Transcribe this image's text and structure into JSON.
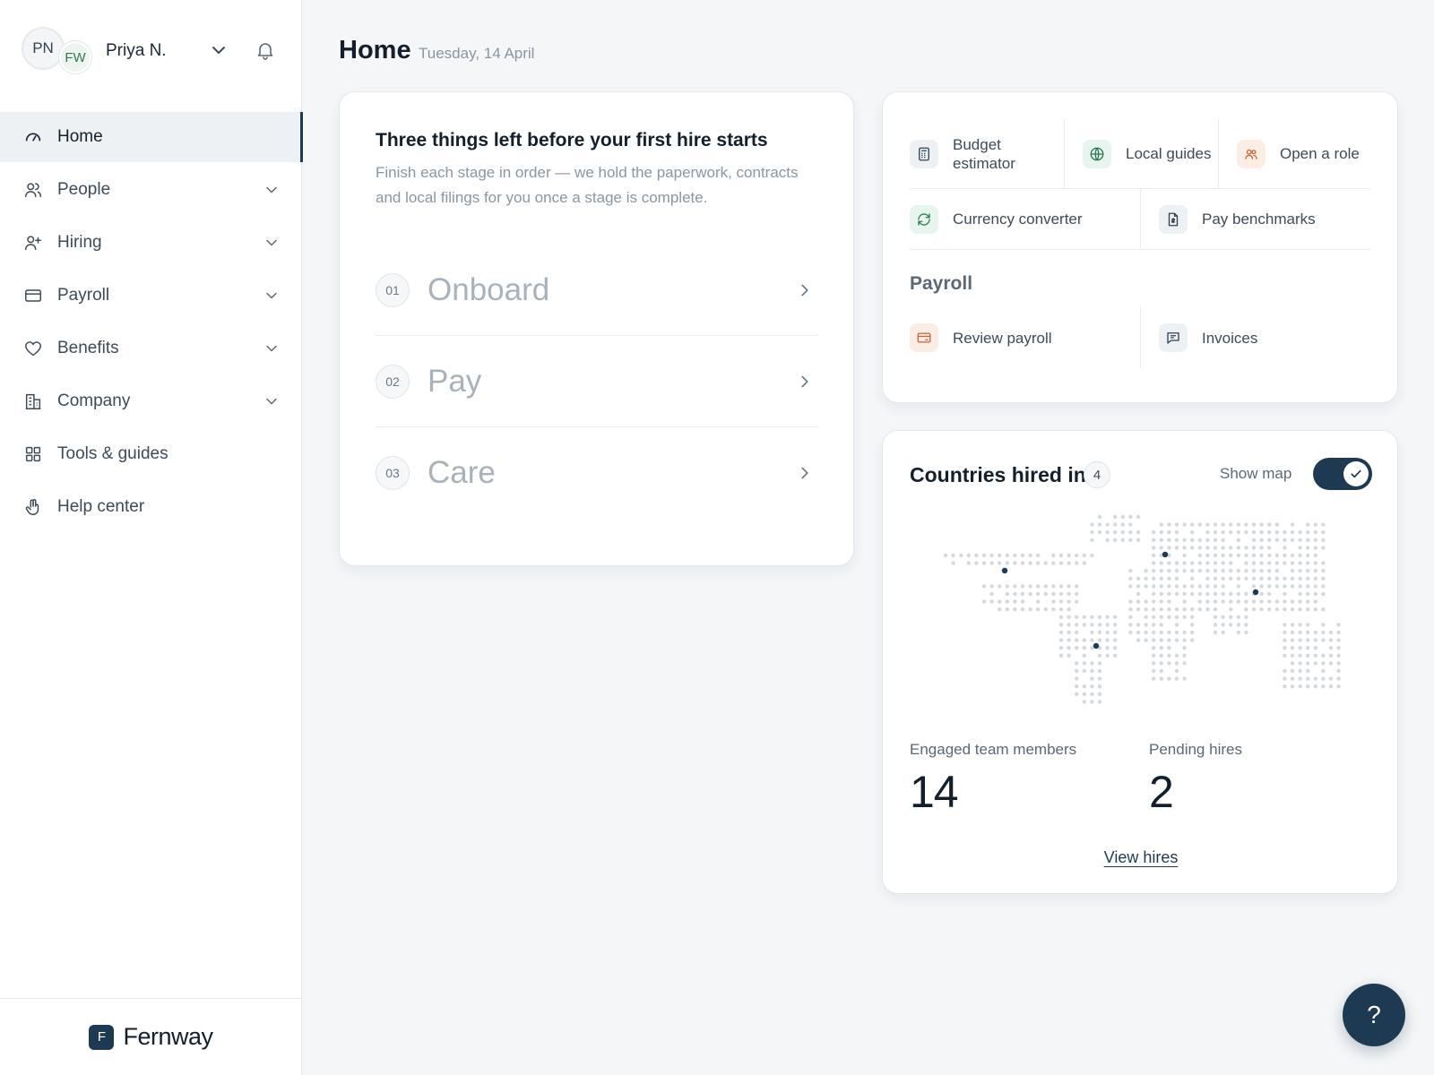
{
  "user": {
    "initials": "PN",
    "workspace_initials": "FW",
    "name": "Priya N."
  },
  "icons": {
    "user_menu": "chevron-down-icon",
    "notifications": "bell-icon"
  },
  "nav": [
    {
      "label": "Home",
      "icon": "gauge-icon",
      "active": true,
      "expandable": false
    },
    {
      "label": "People",
      "icon": "users-icon",
      "expandable": true
    },
    {
      "label": "Hiring",
      "icon": "user-plus-icon",
      "expandable": true
    },
    {
      "label": "Payroll",
      "icon": "credit-card-icon",
      "expandable": true
    },
    {
      "label": "Benefits",
      "icon": "heart-icon",
      "expandable": true
    },
    {
      "label": "Company",
      "icon": "building-icon",
      "expandable": true
    },
    {
      "label": "Tools & guides",
      "icon": "grid-icon",
      "expandable": false
    },
    {
      "label": "Help center",
      "icon": "hand-icon",
      "expandable": false
    }
  ],
  "brand": {
    "mark": "F",
    "name": "Fernway"
  },
  "header": {
    "title": "Home",
    "date": "Tuesday, 14 April"
  },
  "steps": {
    "title": "Three things left before your first hire starts",
    "subtitle": "Finish each stage in order — we hold the paperwork, contracts and local filings for you once a stage is complete.",
    "items": [
      {
        "num": "01",
        "label": "Onboard"
      },
      {
        "num": "02",
        "label": "Pay"
      },
      {
        "num": "03",
        "label": "Care"
      }
    ]
  },
  "tools": {
    "row1": [
      {
        "label": "Budget estimator",
        "icon": "calculator-icon"
      },
      {
        "label": "Local guides",
        "icon": "globe-icon"
      },
      {
        "label": "Open a role",
        "icon": "users-icon"
      }
    ],
    "row2": [
      {
        "label": "Currency converter",
        "icon": "refresh-icon"
      },
      {
        "label": "Pay benchmarks",
        "icon": "document-icon"
      }
    ],
    "payroll_heading": "Payroll",
    "row3": [
      {
        "label": "Review payroll",
        "icon": "credit-card-icon"
      },
      {
        "label": "Invoices",
        "icon": "message-icon"
      }
    ]
  },
  "countries": {
    "title": "Countries hired in",
    "count": "4",
    "map_toggle_label": "Show map",
    "map_enabled": true,
    "stats": [
      {
        "label": "Engaged team members",
        "value": "14"
      },
      {
        "label": "Pending hires",
        "value": "2"
      }
    ],
    "link": "View hires"
  },
  "help_fab": "?",
  "colors": {
    "accent": "#1e3a52",
    "map_dot": "#d3d9de",
    "map_marker": "#1e3a52"
  }
}
